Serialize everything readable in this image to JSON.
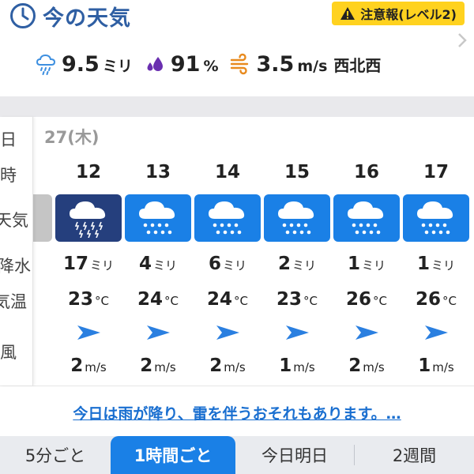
{
  "header": {
    "title": "今の天気",
    "alert_label": "注意報(レベル2)"
  },
  "current": {
    "precip_value": "9.5",
    "precip_unit": "ミリ",
    "humidity_value": "91",
    "humidity_unit": "%",
    "wind_value": "3.5",
    "wind_unit": "m/s",
    "wind_direction": "西北西"
  },
  "row_labels": {
    "day": "日",
    "time": "時",
    "weather": "天気",
    "precip": "降水",
    "temp": "気温",
    "wind": "風"
  },
  "forecast": {
    "date": "27(木)",
    "hours": [
      {
        "hour": "12",
        "weather": "thunder-rain-icon",
        "precip": "17",
        "precip_unit": "ミリ",
        "temp": "23",
        "temp_unit": "°C",
        "wind_speed": "2",
        "wind_unit": "m/s"
      },
      {
        "hour": "13",
        "weather": "rain-icon",
        "precip": "4",
        "precip_unit": "ミリ",
        "temp": "24",
        "temp_unit": "°C",
        "wind_speed": "2",
        "wind_unit": "m/s"
      },
      {
        "hour": "14",
        "weather": "rain-icon",
        "precip": "6",
        "precip_unit": "ミリ",
        "temp": "24",
        "temp_unit": "°C",
        "wind_speed": "2",
        "wind_unit": "m/s"
      },
      {
        "hour": "15",
        "weather": "rain-icon",
        "precip": "2",
        "precip_unit": "ミリ",
        "temp": "23",
        "temp_unit": "°C",
        "wind_speed": "1",
        "wind_unit": "m/s"
      },
      {
        "hour": "16",
        "weather": "rain-icon",
        "precip": "1",
        "precip_unit": "ミリ",
        "temp": "26",
        "temp_unit": "°C",
        "wind_speed": "2",
        "wind_unit": "m/s"
      },
      {
        "hour": "17",
        "weather": "rain-icon",
        "precip": "1",
        "precip_unit": "ミリ",
        "temp": "26",
        "temp_unit": "°C",
        "wind_speed": "1",
        "wind_unit": "m/s"
      }
    ]
  },
  "summary": {
    "text": "今日は雨が降り、雷を伴うおそれもあります。…"
  },
  "tabs": {
    "t1": "5分ごと",
    "t2": "1時間ごと",
    "t3": "今日明日",
    "t4": "2週間"
  },
  "colors": {
    "accent": "#1a80e6",
    "thunder": "#253f7d",
    "alert": "#ffd21f",
    "link": "#1a6fd0",
    "title": "#2f5fa3"
  }
}
